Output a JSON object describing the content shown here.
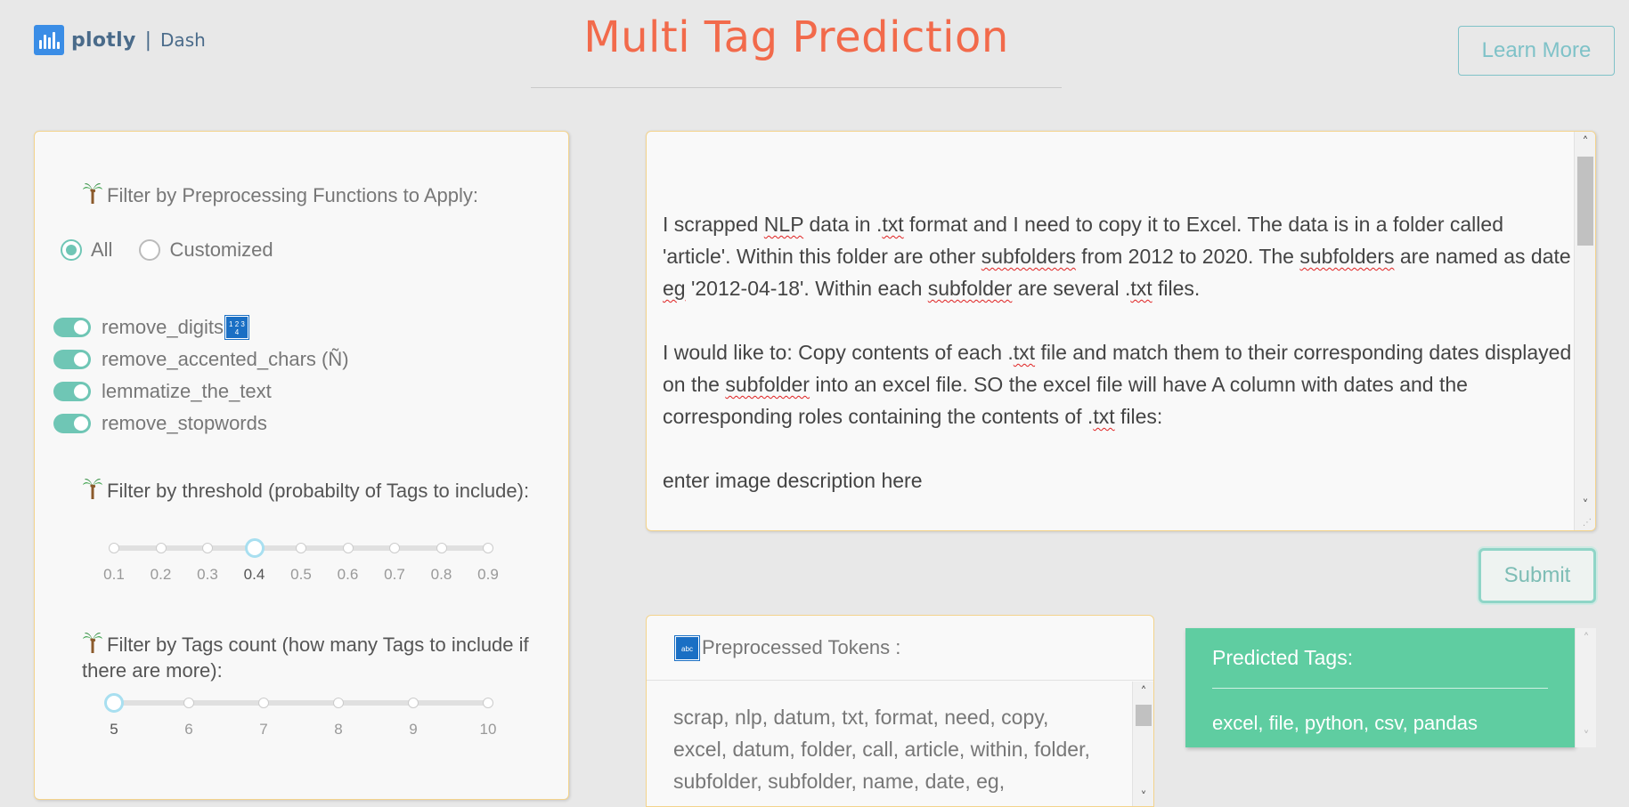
{
  "header": {
    "logo_brand": "plotly",
    "logo_separator": "|",
    "logo_product": "Dash",
    "title": "Multi Tag Prediction",
    "learn_more_label": "Learn More"
  },
  "filters": {
    "preprocessing_label": "Filter by Preprocessing Functions to Apply:",
    "radio_options": [
      {
        "label": "All",
        "checked": true
      },
      {
        "label": "Customized",
        "checked": false
      }
    ],
    "toggles": [
      {
        "label": "remove_digits",
        "on": true
      },
      {
        "label": "remove_accented_chars (Ñ)",
        "on": true
      },
      {
        "label": "lemmatize_the_text",
        "on": true
      },
      {
        "label": "remove_stopwords",
        "on": true
      }
    ],
    "digits_badge": "1 2 3 4",
    "threshold_label": "Filter by threshold (probabilty of Tags to include):",
    "threshold_marks": [
      "0.1",
      "0.2",
      "0.3",
      "0.4",
      "0.5",
      "0.6",
      "0.7",
      "0.8",
      "0.9"
    ],
    "threshold_value": 0.4,
    "count_label": "Filter by Tags count (how many Tags to include if there are more):",
    "count_marks": [
      "5",
      "6",
      "7",
      "8",
      "9",
      "10"
    ],
    "count_value": 5
  },
  "input_text": {
    "paragraph_1": "I scrapped NLP data in .txt format and I need to copy it to Excel. The data is in a folder called 'article'. Within this folder are other subfolders from 2012 to 2020. The subfolders are named as date eg '2012-04-18'. Within each subfolder are several .txt files.",
    "paragraph_2": "I would like to: Copy contents of each .txt file and match them to their corresponding dates displayed on the subfolder into an excel file. SO the excel file will have A column with dates and the corresponding roles containing the contents of .txt files:",
    "paragraph_3": "enter image description here"
  },
  "submit_label": "Submit",
  "tokens": {
    "badge": "abc",
    "header": "Preprocessed Tokens :",
    "body": "scrap, nlp, datum, txt, format, need, copy, excel, datum, folder, call, article, within, folder, subfolder, subfolder, name, date, eg,"
  },
  "predicted": {
    "title": "Predicted Tags:",
    "value": "excel, file, python, csv, pandas"
  },
  "colors": {
    "title": "#f26a4b",
    "accent_teal": "#6fc6b5",
    "tags_green": "#5fcda1",
    "panel_border": "#f3d38c",
    "logo_blue": "#3a8de6"
  },
  "icons": {
    "palm": "palm-tree-icon",
    "digits": "input-numbers-icon",
    "abc": "input-latin-letters-icon"
  }
}
